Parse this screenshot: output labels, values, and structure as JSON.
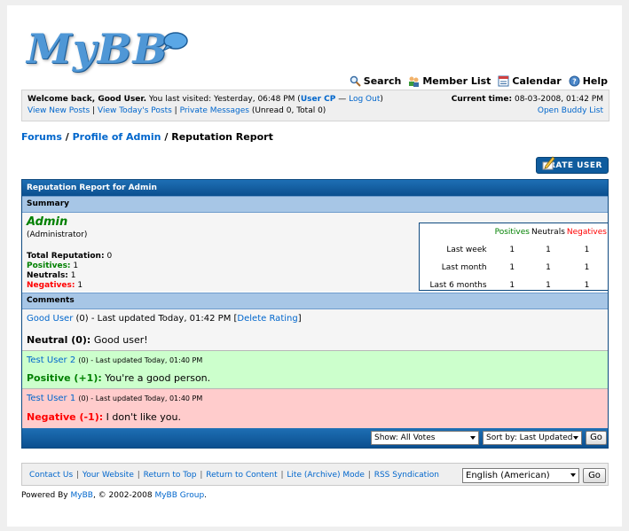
{
  "toplinks": {
    "search": "Search",
    "member_list": "Member List",
    "calendar": "Calendar",
    "help": "Help"
  },
  "welcome": {
    "greeting": "Welcome back, Good User.",
    "last_visited": "You last visited: Yesterday, 06:48 PM (",
    "user_cp": "User CP",
    "dash": " — ",
    "log_out": "Log Out",
    "close_paren": ")",
    "view_new_posts": "View New Posts",
    "view_todays_posts": "View Today's Posts",
    "private_messages": "Private Messages",
    "pm_counts": "(Unread 0, Total 0)",
    "current_time_label": "Current time:",
    "current_time": "08-03-2008, 01:42 PM",
    "open_buddy_list": "Open Buddy List"
  },
  "breadcrumb": {
    "forums": "Forums",
    "profile": "Profile of Admin",
    "current": "Reputation Report",
    "sep": "/"
  },
  "rate_user_button": "RATE USER",
  "report": {
    "title": "Reputation Report for Admin",
    "summary_header": "Summary",
    "user_name": "Admin",
    "user_role": "(Administrator)",
    "total_label": "Total Reputation:",
    "total_value": "0",
    "positives_label": "Positives:",
    "positives_value": "1",
    "neutrals_label": "Neutrals:",
    "neutrals_value": "1",
    "negatives_label": "Negatives:",
    "negatives_value": "1",
    "stats": {
      "col_positives": "Positives",
      "col_neutrals": "Neutrals",
      "col_negatives": "Negatives",
      "rows": [
        {
          "label": "Last week",
          "pos": "1",
          "neu": "1",
          "neg": "1"
        },
        {
          "label": "Last month",
          "pos": "1",
          "neu": "1",
          "neg": "1"
        },
        {
          "label": "Last 6 months",
          "pos": "1",
          "neu": "1",
          "neg": "1"
        }
      ]
    },
    "comments_header": "Comments",
    "comments": [
      {
        "user": "Good User",
        "meta": "(0) - Last updated Today, 01:42 PM [",
        "delete": "Delete Rating",
        "meta_end": "]",
        "type": "Neutral (0):",
        "text": "Good user!",
        "bg": "#f5f5f5",
        "color": "#000000"
      },
      {
        "user": "Test User 2",
        "meta": "(0) - Last updated Today, 01:40 PM",
        "type": "Positive (+1):",
        "text": "You're a good person.",
        "bg": "#ccffcc",
        "color": "#008000"
      },
      {
        "user": "Test User 1",
        "meta": "(0) - Last updated Today, 01:40 PM",
        "type": "Negative (-1):",
        "text": "I don't like you.",
        "bg": "#ffcccc",
        "color": "#ff0000"
      }
    ],
    "show_select": "Show: All Votes",
    "sort_select": "Sort by: Last Updated",
    "go": "Go"
  },
  "footer": {
    "contact_us": "Contact Us",
    "your_website": "Your Website",
    "return_to_top": "Return to Top",
    "return_to_content": "Return to Content",
    "lite_mode": "Lite (Archive) Mode",
    "rss": "RSS Syndication",
    "language": "English (American)",
    "go": "Go",
    "powered_by": "Powered By",
    "mybb": "MyBB",
    "copyright": ", © 2002-2008",
    "mybb_group": "MyBB Group",
    "period": "."
  }
}
